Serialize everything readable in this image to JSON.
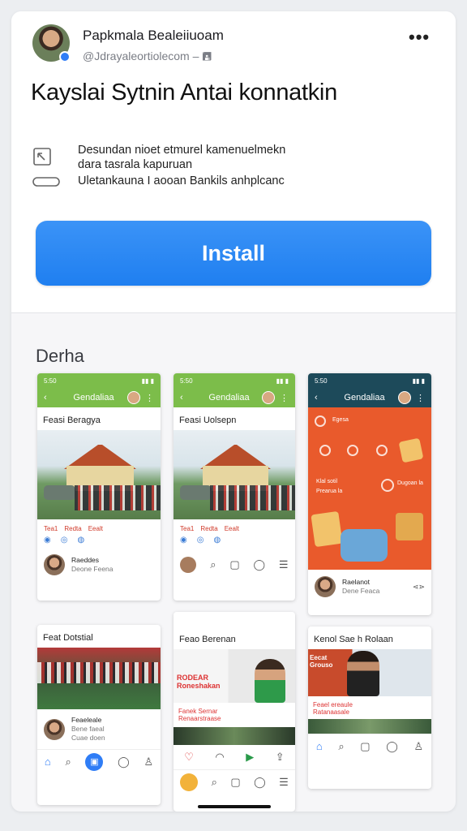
{
  "publisher": {
    "name": "Papkmala Bealeiiuoam",
    "handle": "@Jdrayaleortiolecom – 🖪",
    "more_label": "•••"
  },
  "app": {
    "title": "Kayslai Sytnin Antai konnatkin"
  },
  "features": [
    {
      "icon": "share-icon",
      "text": "Desundan nioet etmurel kamenuelmekn\ndara tasrala kapuruan"
    },
    {
      "icon": "link-icon",
      "text": "Uletankauna I aooan Bankils anhplcanc"
    }
  ],
  "install": {
    "label": "Install"
  },
  "screenshots": {
    "section_title": "Derha",
    "shot1": {
      "status": "5:50",
      "header_title": "Gendaliaa",
      "post_title": "Feasi Beragya",
      "meta": [
        "Tea1",
        "Redta",
        "Eealt"
      ],
      "author_name": "Raeddes",
      "author_sub": "Deone Feena"
    },
    "shot2": {
      "status": "5:50",
      "header_title": "Gendaliaa",
      "post_title": "Feasi Uolsepn",
      "meta": [
        "Tea1",
        "Redta",
        "Eealt"
      ]
    },
    "shot3": {
      "status": "5:50",
      "header_title": "Gendaliaa",
      "promo_lines": [
        "Egesa",
        "Klal sotil",
        "Prearua la",
        "Dugoan la"
      ],
      "author_name": "Raelanot",
      "author_sub": "Dene Feaca"
    },
    "shot4": {
      "post_title": "Feat Dotstial",
      "author_name": "Feaeleale",
      "author_sub": "Bene faeal",
      "author_extra": "Cuae doen"
    },
    "shot5": {
      "post_title": "Feao Berenan",
      "banner_text": "RODEAR\nRoneshakan",
      "line1": "Fanek Sernar",
      "line2": "Renaarstraase"
    },
    "shot6": {
      "post_title": "Kenol Sae h Rolaan",
      "banner_text": "Eecat\nGrouso",
      "line1": "Feael ereaule",
      "line2": "Ratanaasale"
    }
  }
}
